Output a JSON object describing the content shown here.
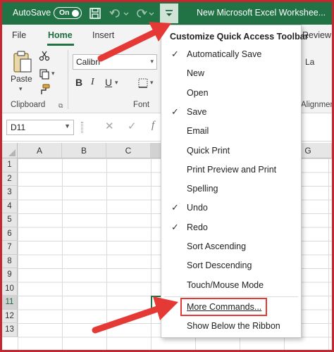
{
  "titlebar": {
    "autosave_label": "AutoSave",
    "autosave_toggle": "On",
    "window_title": "New Microsoft Excel Workshee..."
  },
  "tabs": [
    {
      "label": "File"
    },
    {
      "label": "Home"
    },
    {
      "label": "Insert"
    },
    {
      "label": "Review"
    }
  ],
  "ribbon": {
    "clipboard": {
      "paste_label": "Paste",
      "group_label": "Clipboard"
    },
    "font": {
      "font_name": "Calibri",
      "group_label": "Font"
    },
    "alignment": {
      "group_label": "Alignment"
    },
    "la_label": "La"
  },
  "formula_bar": {
    "name_box": "D11",
    "fx": "f"
  },
  "grid": {
    "columns": [
      "A",
      "B",
      "C",
      "G"
    ],
    "rows": [
      "1",
      "2",
      "3",
      "4",
      "5",
      "6",
      "7",
      "8",
      "9",
      "10",
      "11",
      "12",
      "13"
    ]
  },
  "menu": {
    "header": "Customize Quick Access Toolbar",
    "items": [
      {
        "label": "Automatically Save",
        "checked": true
      },
      {
        "label": "New",
        "checked": false
      },
      {
        "label": "Open",
        "checked": false
      },
      {
        "label": "Save",
        "checked": true
      },
      {
        "label": "Email",
        "checked": false
      },
      {
        "label": "Quick Print",
        "checked": false
      },
      {
        "label": "Print Preview and Print",
        "checked": false
      },
      {
        "label": "Spelling",
        "checked": false
      },
      {
        "label": "Undo",
        "checked": true
      },
      {
        "label": "Redo",
        "checked": true
      },
      {
        "label": "Sort Ascending",
        "checked": false
      },
      {
        "label": "Sort Descending",
        "checked": false
      },
      {
        "label": "Touch/Mouse Mode",
        "checked": false
      },
      {
        "label": "More Commands...",
        "checked": false
      },
      {
        "label": "Show Below the Ribbon",
        "checked": false
      }
    ],
    "check_glyph": "✓"
  },
  "colors": {
    "excel_green": "#217346",
    "annotation_red": "#e53935"
  }
}
